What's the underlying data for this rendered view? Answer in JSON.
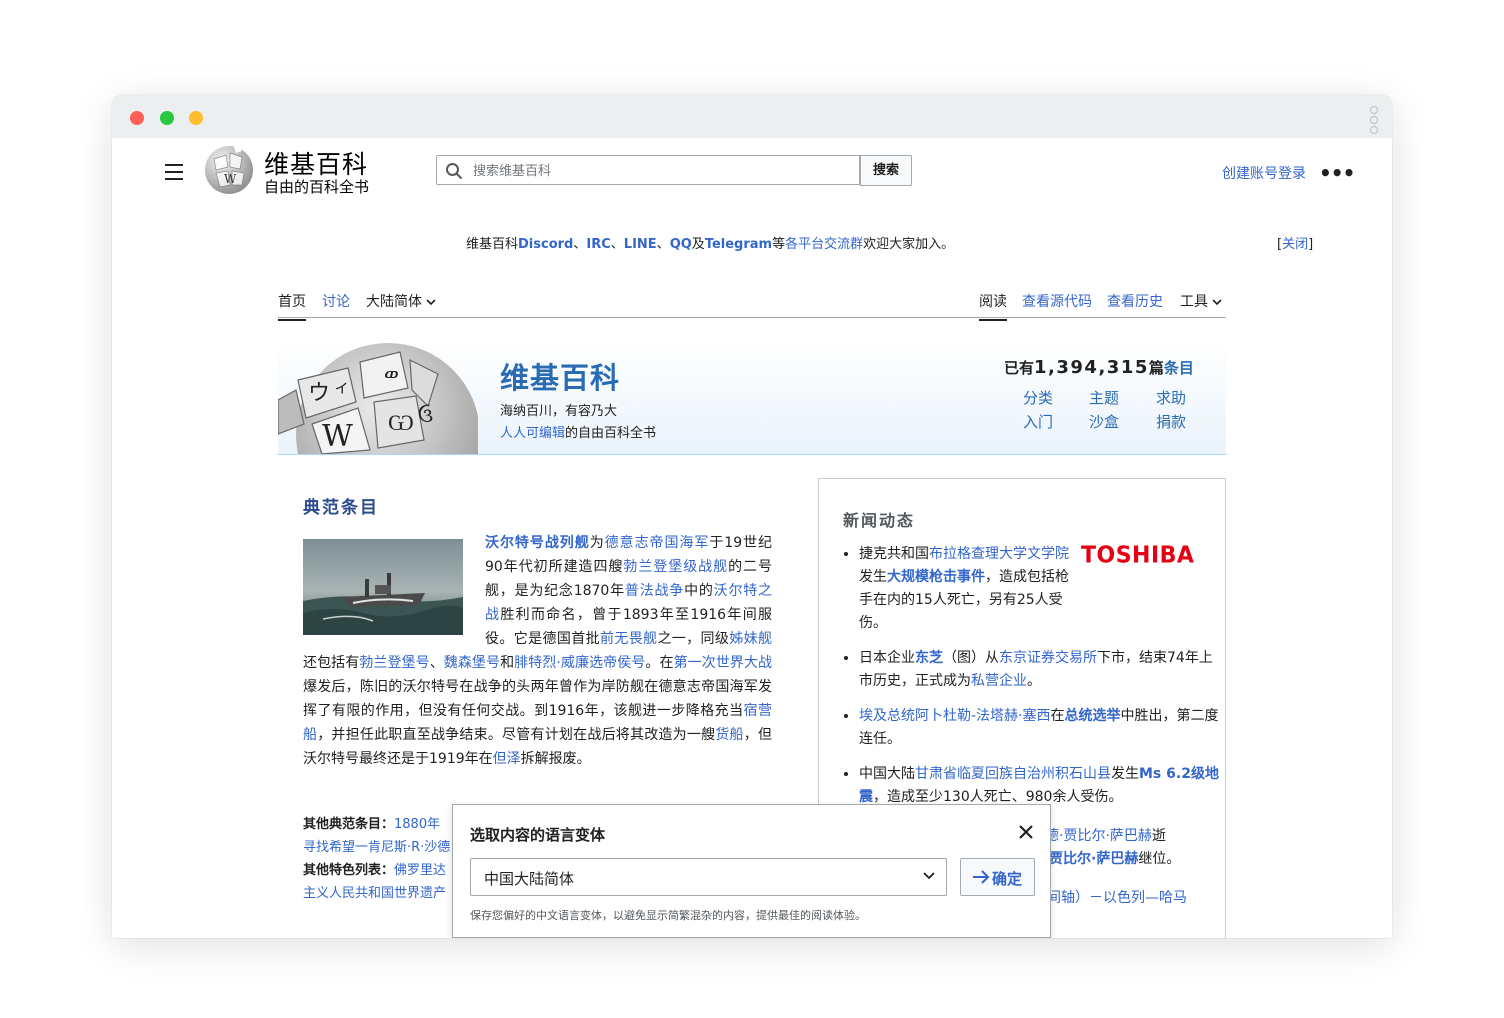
{
  "header": {
    "wordmark": "维基百科",
    "tagline": "自由的百科全书",
    "search_placeholder": "搜索维基百科",
    "search_button": "搜索",
    "create_account": "创建账号",
    "login": "登录",
    "more": "•••"
  },
  "notice": {
    "prefix": "维基百科",
    "discord": "Discord",
    "sep1": "、",
    "irc": "IRC",
    "sep2": "、",
    "line": "LINE",
    "sep3": "、",
    "qq": "QQ",
    "and": "及",
    "telegram": "Telegram",
    "etc": "等",
    "groups": "各平台交流群",
    "suffix": "欢迎大家加入。",
    "close_open": "[",
    "close": "关闭",
    "close_end": "]"
  },
  "tabs": {
    "main": "首页",
    "talk": "讨论",
    "variant": "大陆简体",
    "read": "阅读",
    "view_source": "查看源代码",
    "history": "查看历史",
    "tools": "工具"
  },
  "banner": {
    "title": "维基百科",
    "line1": "海纳百川，有容乃大",
    "line2_link": "人人可编辑",
    "line2_rest": "的自由百科全书",
    "count_prefix": "已有",
    "count": "1,394,315",
    "count_unit": "篇",
    "count_link": "条目",
    "links": [
      "分类",
      "主题",
      "求助",
      "入门",
      "沙盒",
      "捐款"
    ]
  },
  "featured": {
    "heading": "典范条目",
    "p": [
      {
        "t": "沃尔特号战列舰",
        "l": true,
        "b": true
      },
      {
        "t": "为"
      },
      {
        "t": "德意志帝国海军",
        "l": true
      },
      {
        "t": "于19世纪90年代初所建造四艘"
      },
      {
        "t": "勃兰登堡级战舰",
        "l": true
      },
      {
        "t": "的二号舰，是为纪念1870年"
      },
      {
        "t": "普法战争",
        "l": true
      },
      {
        "t": "中的"
      },
      {
        "t": "沃尔特之战",
        "l": true
      },
      {
        "t": "胜利而命名，曾于1893年至1916年间服役。它是德国首批"
      },
      {
        "t": "前无畏舰",
        "l": true
      },
      {
        "t": "之一，同级"
      },
      {
        "t": "姊妹舰",
        "l": true
      },
      {
        "t": "还包括有"
      },
      {
        "t": "勃兰登堡号",
        "l": true
      },
      {
        "t": "、"
      },
      {
        "t": "魏森堡号",
        "l": true
      },
      {
        "t": "和"
      },
      {
        "t": "腓特烈·威廉选帝侯号",
        "l": true
      },
      {
        "t": "。在"
      },
      {
        "t": "第一次世界大战",
        "l": true
      },
      {
        "t": "爆发后，陈旧的沃尔特号在战争的头两年曾作为岸防舰在德意志帝国海军发挥了有限的作用，但没有任何交战。到1916年，该舰进一步降格充当"
      },
      {
        "t": "宿营船",
        "l": true
      },
      {
        "t": "，并担任此职直至战争结束。尽管有计划在战后将其改造为一艘"
      },
      {
        "t": "货船",
        "l": true
      },
      {
        "t": "，但沃尔特号最终还是于1919年在"
      },
      {
        "t": "但泽",
        "l": true
      },
      {
        "t": "拆解报废。"
      }
    ],
    "more_label": "其他典范条目：",
    "more_items": "1880年",
    "more_line2": "寻找希望一肯尼斯·R·沙德",
    "list_label": "其他特色列表：",
    "list_items": "佛罗里达",
    "list_line2": "主义人民共和国世界遗产"
  },
  "news": {
    "heading": "新闻动态",
    "toshiba_logo": "TOSHIBA",
    "items": [
      [
        {
          "t": "捷克共和国"
        },
        {
          "t": "布拉格查理大学文学院",
          "l": true
        },
        {
          "t": "发生"
        },
        {
          "t": "大规模枪击事件",
          "l": true,
          "b": true
        },
        {
          "t": "，造成包括枪手在内的15人死亡，另有25人受伤。"
        }
      ],
      [
        {
          "t": "日本企业"
        },
        {
          "t": "东芝",
          "l": true,
          "b": true
        },
        {
          "t": "（图）从"
        },
        {
          "t": "东京证券交易所",
          "l": true
        },
        {
          "t": "下市，结束74年上市历史，正式成为"
        },
        {
          "t": "私营企业",
          "l": true
        },
        {
          "t": "。"
        }
      ],
      [
        {
          "t": "埃及总统阿卜杜勒-法塔赫·塞西",
          "l": true
        },
        {
          "t": "在"
        },
        {
          "t": "总统选举",
          "l": true,
          "b": true
        },
        {
          "t": "中胜出，第二度连任。"
        }
      ],
      [
        {
          "t": "中国大陆"
        },
        {
          "t": "甘肃省临夏回族自治州积石山县",
          "l": true
        },
        {
          "t": "发生"
        },
        {
          "t": "Ms 6.2级地震",
          "l": true,
          "b": true
        },
        {
          "t": "，造成至少130人死亡、980余人受伤。"
        }
      ]
    ],
    "partial1": "德·贾比尔·萨巴赫",
    "partial1b": "逝",
    "partial2": "贾比尔·萨巴赫",
    "partial2b": "继位。",
    "partial3": "间轴）－以色列—哈马"
  },
  "dialog": {
    "title": "选取内容的语言变体",
    "selected": "中国大陆简体",
    "ok": "确定",
    "note": "保存您偏好的中文语言变体，以避免显示简繁混杂的内容，提供最佳的阅读体验。"
  }
}
